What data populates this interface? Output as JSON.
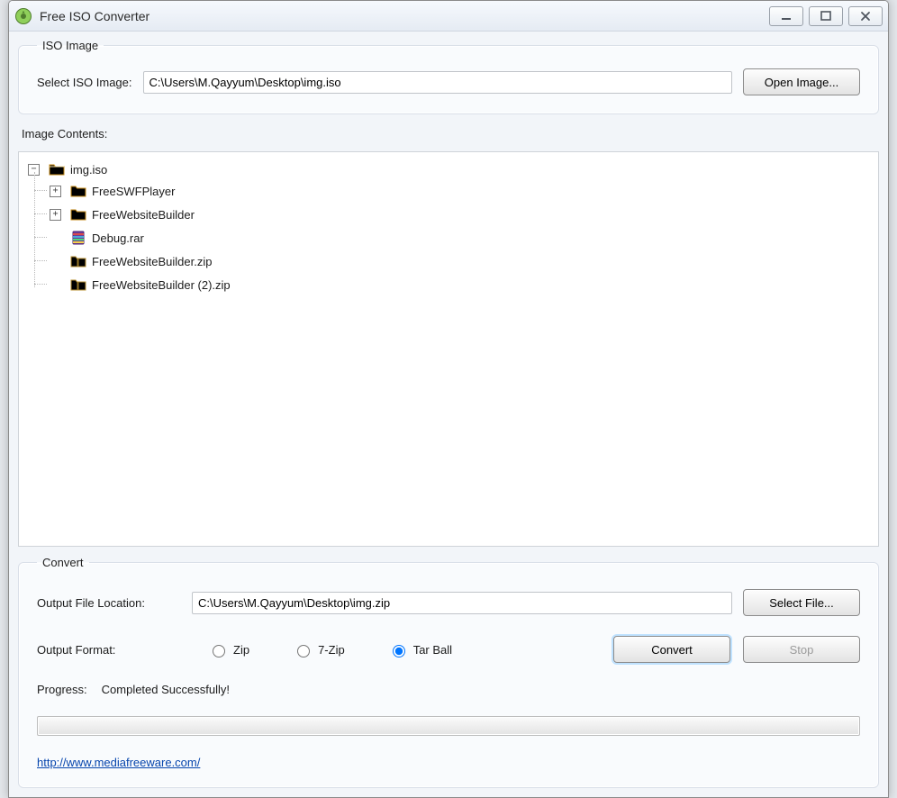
{
  "window": {
    "title": "Free ISO Converter"
  },
  "iso_image": {
    "legend": "ISO Image",
    "select_label": "Select ISO Image:",
    "path": "C:\\Users\\M.Qayyum\\Desktop\\img.iso",
    "open_button": "Open Image..."
  },
  "contents": {
    "label": "Image Contents:",
    "tree": {
      "root": {
        "name": "img.iso",
        "children": [
          {
            "name": "FreeSWFPlayer",
            "type": "folder",
            "expandable": true
          },
          {
            "name": "FreeWebsiteBuilder",
            "type": "folder",
            "expandable": true
          },
          {
            "name": "Debug.rar",
            "type": "rar"
          },
          {
            "name": "FreeWebsiteBuilder.zip",
            "type": "zip"
          },
          {
            "name": "FreeWebsiteBuilder (2).zip",
            "type": "zip"
          }
        ]
      }
    }
  },
  "convert": {
    "legend": "Convert",
    "output_label": "Output File Location:",
    "output_path": "C:\\Users\\M.Qayyum\\Desktop\\img.zip",
    "select_file_button": "Select File...",
    "format_label": "Output Format:",
    "formats": {
      "zip": "Zip",
      "sevenzip": "7-Zip",
      "tarball": "Tar Ball"
    },
    "selected_format": "tarball",
    "convert_button": "Convert",
    "stop_button": "Stop",
    "progress_label": "Progress:",
    "progress_status": "Completed Successfully!",
    "link": "http://www.mediafreeware.com/"
  }
}
